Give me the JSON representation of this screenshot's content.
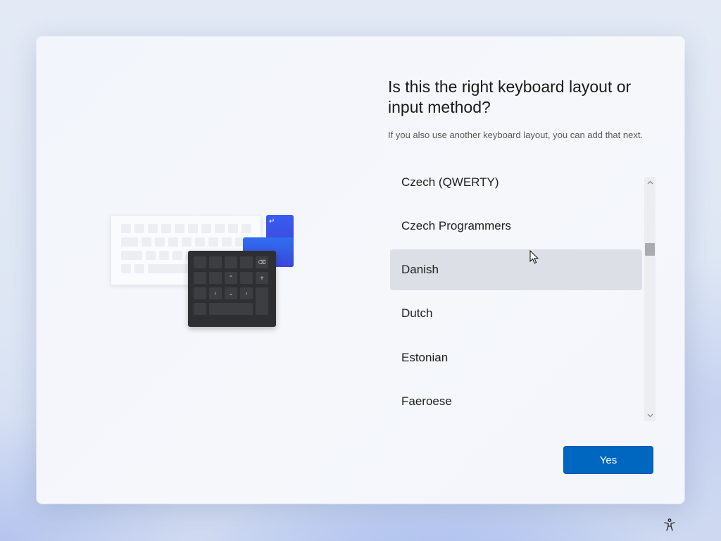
{
  "page": {
    "title": "Is this the right keyboard layout or input method?",
    "subtitle": "If you also use another keyboard layout, you can add that next."
  },
  "layouts": {
    "items": [
      {
        "label": "Czech (QWERTY)",
        "selected": false
      },
      {
        "label": "Czech Programmers",
        "selected": false
      },
      {
        "label": "Danish",
        "selected": true
      },
      {
        "label": "Dutch",
        "selected": false
      },
      {
        "label": "Estonian",
        "selected": false
      },
      {
        "label": "Faeroese",
        "selected": false
      }
    ],
    "selected": "Danish"
  },
  "scrollbar": {
    "up_icon": "chevron-up-icon",
    "down_icon": "chevron-down-icon"
  },
  "actions": {
    "yes_label": "Yes"
  },
  "footer": {
    "accessibility_icon": "accessibility-icon"
  },
  "colors": {
    "accent": "#0067c0",
    "selected_row": "#dcdfe6"
  }
}
